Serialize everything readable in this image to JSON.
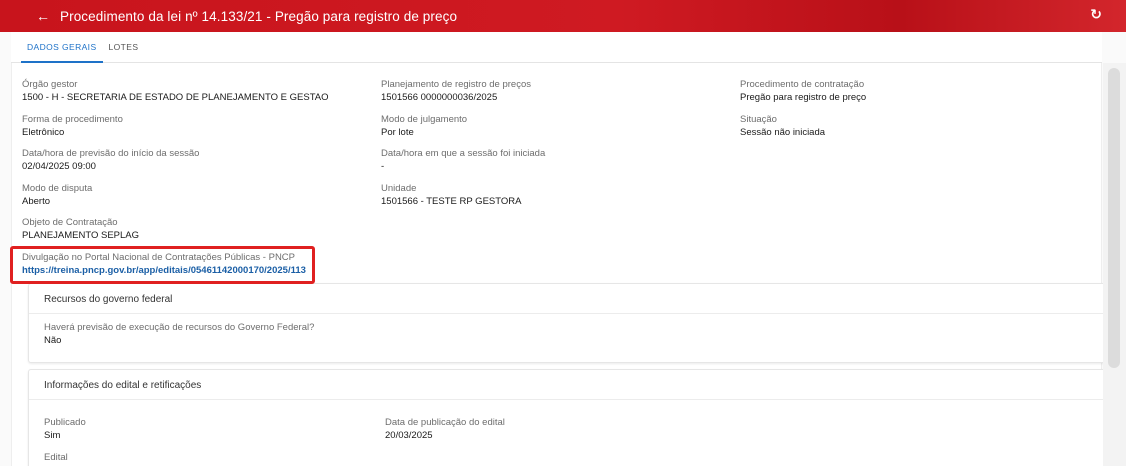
{
  "header": {
    "back_icon": "←",
    "title": "Procedimento da lei nº 14.133/21 - Pregão para registro de preço",
    "refresh_icon": "↻"
  },
  "tabs": [
    {
      "label": "DADOS GERAIS",
      "active": true
    },
    {
      "label": "LOTES",
      "active": false
    }
  ],
  "fields": {
    "orgao_gestor": {
      "label": "Órgão gestor",
      "value": "1500 - H - SECRETARIA DE ESTADO DE PLANEJAMENTO E GESTAO"
    },
    "planejamento": {
      "label": "Planejamento de registro de preços",
      "value": "1501566 0000000036/2025"
    },
    "procedimento": {
      "label": "Procedimento de contratação",
      "value": "Pregão para registro de preço"
    },
    "forma": {
      "label": "Forma de procedimento",
      "value": "Eletrônico"
    },
    "modo_julgamento": {
      "label": "Modo de julgamento",
      "value": "Por lote"
    },
    "situacao": {
      "label": "Situação",
      "value": "Sessão não iniciada"
    },
    "previsao_inicio": {
      "label": "Data/hora de previsão do início da sessão",
      "value": "02/04/2025 09:00"
    },
    "sessao_iniciada": {
      "label": "Data/hora em que a sessão foi iniciada",
      "value": "-"
    },
    "modo_disputa": {
      "label": "Modo de disputa",
      "value": "Aberto"
    },
    "unidade": {
      "label": "Unidade",
      "value": "1501566 - TESTE RP GESTORA"
    },
    "objeto": {
      "label": "Objeto de Contratação",
      "value": "PLANEJAMENTO SEPLAG"
    },
    "pncp": {
      "label": "Divulgação no Portal Nacional de Contratações Públicas - PNCP",
      "value": "https://treina.pncp.gov.br/app/editais/05461142000170/2025/113"
    }
  },
  "cards": {
    "recursos": {
      "title": "Recursos do governo federal",
      "question_label": "Haverá previsão de execução de recursos do Governo Federal?",
      "question_value": "Não"
    },
    "edital": {
      "title": "Informações do edital e retificações",
      "publicado_label": "Publicado",
      "publicado_value": "Sim",
      "data_publicacao_label": "Data de publicação do edital",
      "data_publicacao_value": "20/03/2025",
      "edital_label": "Edital"
    }
  },
  "colors": {
    "header_red": "#c8141c",
    "tab_active_blue": "#1e72c8",
    "link_blue": "#1b5fa6",
    "highlight_red": "#e02020"
  }
}
